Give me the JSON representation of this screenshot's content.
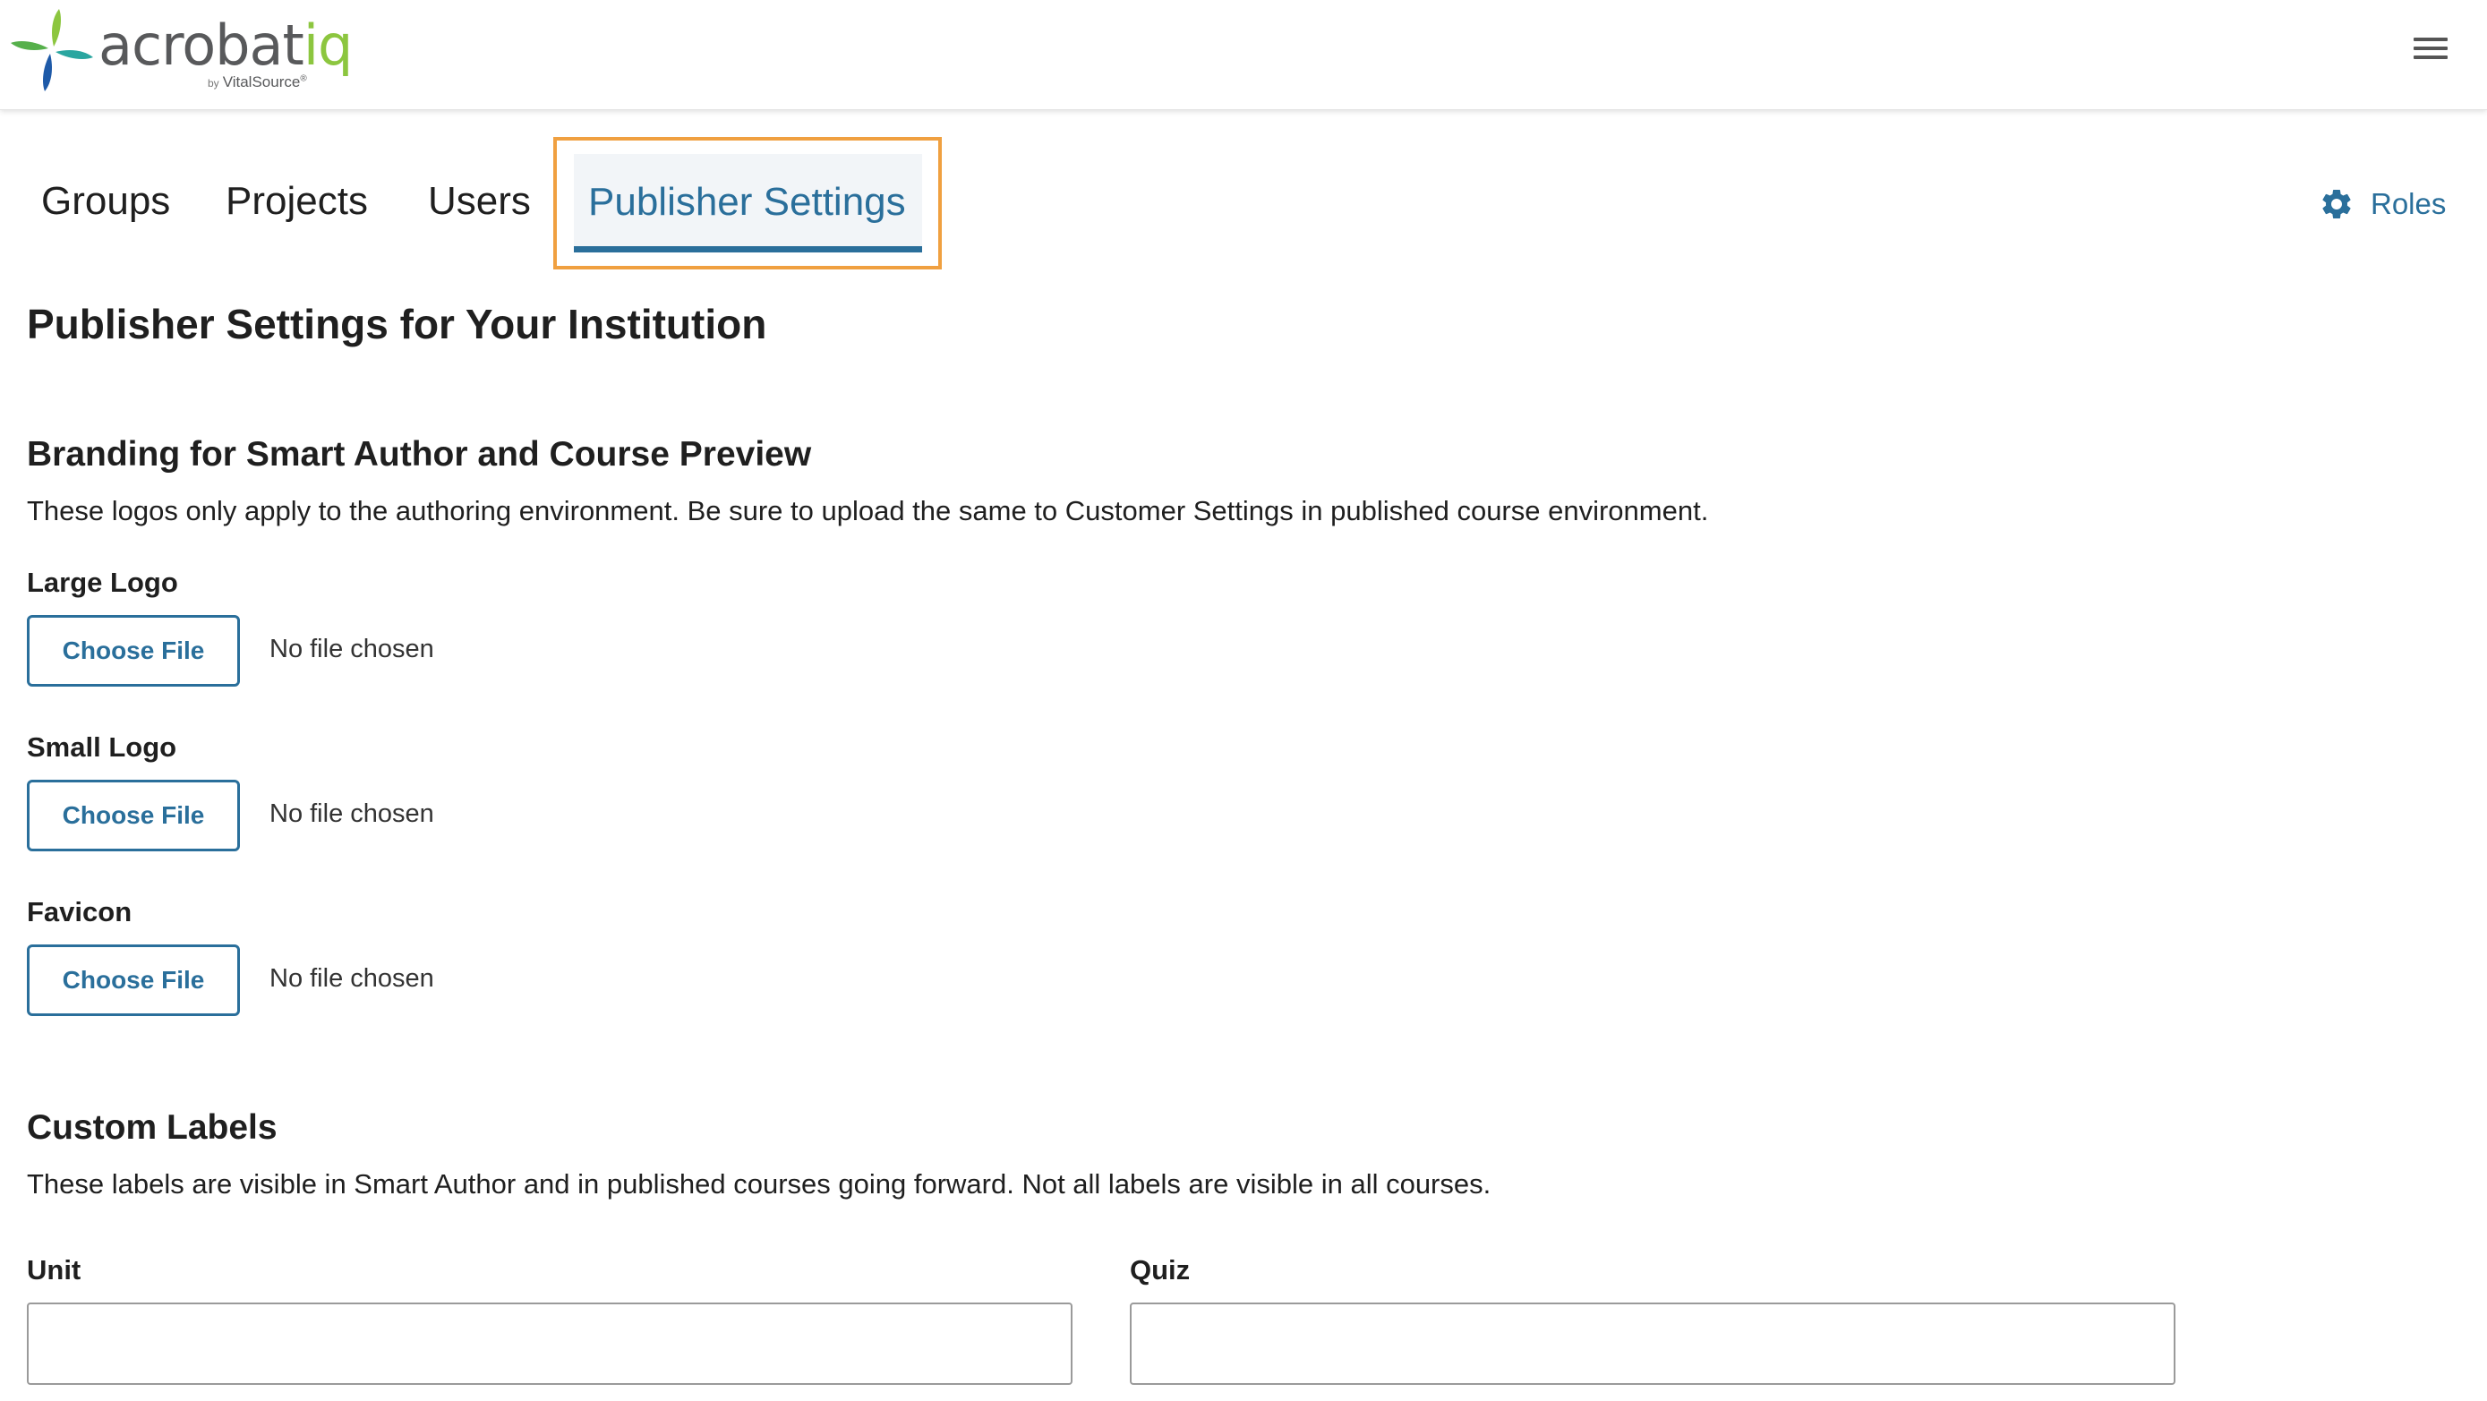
{
  "brand": {
    "name_main": "acrobat",
    "name_accent": "iq",
    "by_prefix": "by",
    "by_name": "VitalSource",
    "by_reg": "®"
  },
  "tabs": [
    {
      "label": "Groups",
      "active": false
    },
    {
      "label": "Projects",
      "active": false
    },
    {
      "label": "Users",
      "active": false
    },
    {
      "label": "Publisher Settings",
      "active": true
    }
  ],
  "roles": {
    "label": "Roles",
    "icon": "gear-icon"
  },
  "page_title": "Publisher Settings for Your Institution",
  "branding": {
    "title": "Branding for Smart Author and Course Preview",
    "description": "These logos only apply to the authoring environment. Be sure to upload the same to Customer Settings in published course environment.",
    "fields": [
      {
        "label": "Large Logo",
        "button": "Choose File",
        "status": "No file chosen"
      },
      {
        "label": "Small Logo",
        "button": "Choose File",
        "status": "No file chosen"
      },
      {
        "label": "Favicon",
        "button": "Choose File",
        "status": "No file chosen"
      }
    ]
  },
  "custom_labels": {
    "title": "Custom Labels",
    "description": "These labels are visible in Smart Author and in published courses going forward. Not all labels are visible in all courses.",
    "inputs": [
      {
        "label": "Unit",
        "value": ""
      },
      {
        "label": "Quiz",
        "value": ""
      }
    ]
  },
  "colors": {
    "accent": "#2a6f9b",
    "highlight_frame": "#f0a040",
    "logo_green": "#8cc63f",
    "logo_blue": "#1e5aa8",
    "logo_teal": "#2aa6a0"
  }
}
